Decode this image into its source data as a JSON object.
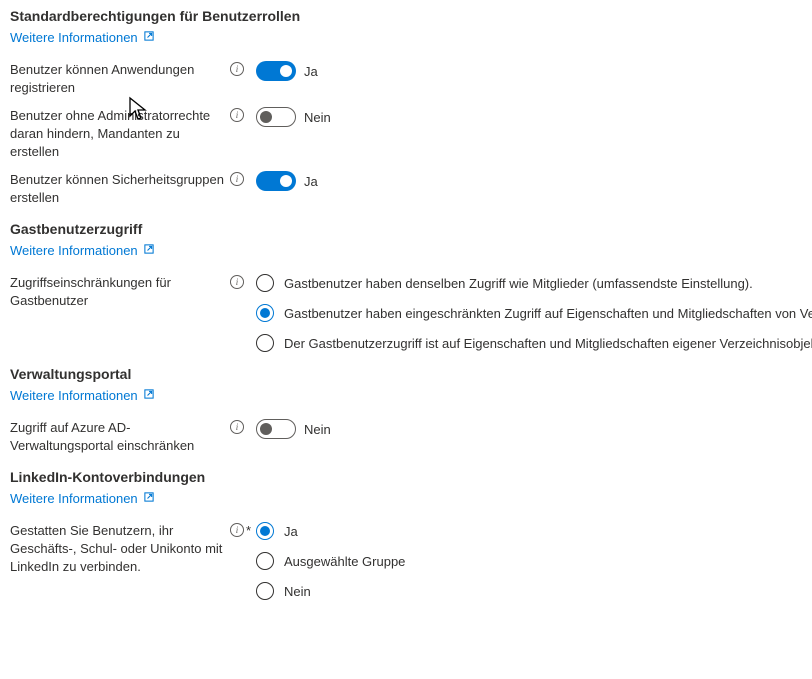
{
  "common": {
    "learnMore": "Weitere Informationen",
    "yes": "Ja",
    "no": "Nein"
  },
  "sections": {
    "defaultRoles": {
      "heading": "Standardberechtigungen für Benutzerrollen",
      "settings": {
        "registerApps": {
          "label": "Benutzer können Anwendungen registrieren",
          "state": "Ja"
        },
        "preventTenant": {
          "label": "Benutzer ohne Administratorrechte daran hindern, Mandanten zu erstellen",
          "state": "Nein"
        },
        "createSecurity": {
          "label": "Benutzer können Sicherheitsgruppen erstellen",
          "state": "Ja"
        }
      }
    },
    "guestAccess": {
      "heading": "Gastbenutzerzugriff",
      "setting": {
        "label": "Zugriffseinschränkungen für Gastbenutzer",
        "options": {
          "same": "Gastbenutzer haben denselben Zugriff wie Mitglieder (umfassendste Einstellung).",
          "limited": "Gastbenutzer haben eingeschränkten Zugriff auf Eigenschaften und Mitgliedschaften von Verzeic",
          "own": "Der Gastbenutzerzugriff ist auf Eigenschaften und Mitgliedschaften eigener Verzeichnisobjekte b"
        }
      }
    },
    "adminPortal": {
      "heading": "Verwaltungsportal",
      "setting": {
        "label": "Zugriff auf Azure AD-Verwaltungsportal einschränken",
        "state": "Nein"
      }
    },
    "linkedin": {
      "heading": "LinkedIn-Kontoverbindungen",
      "setting": {
        "label": "Gestatten Sie Benutzern, ihr Geschäfts-, Schul- oder Unikonto mit LinkedIn zu verbinden.",
        "options": {
          "yes": "Ja",
          "selected": "Ausgewählte Gruppe",
          "no": "Nein"
        }
      }
    }
  }
}
